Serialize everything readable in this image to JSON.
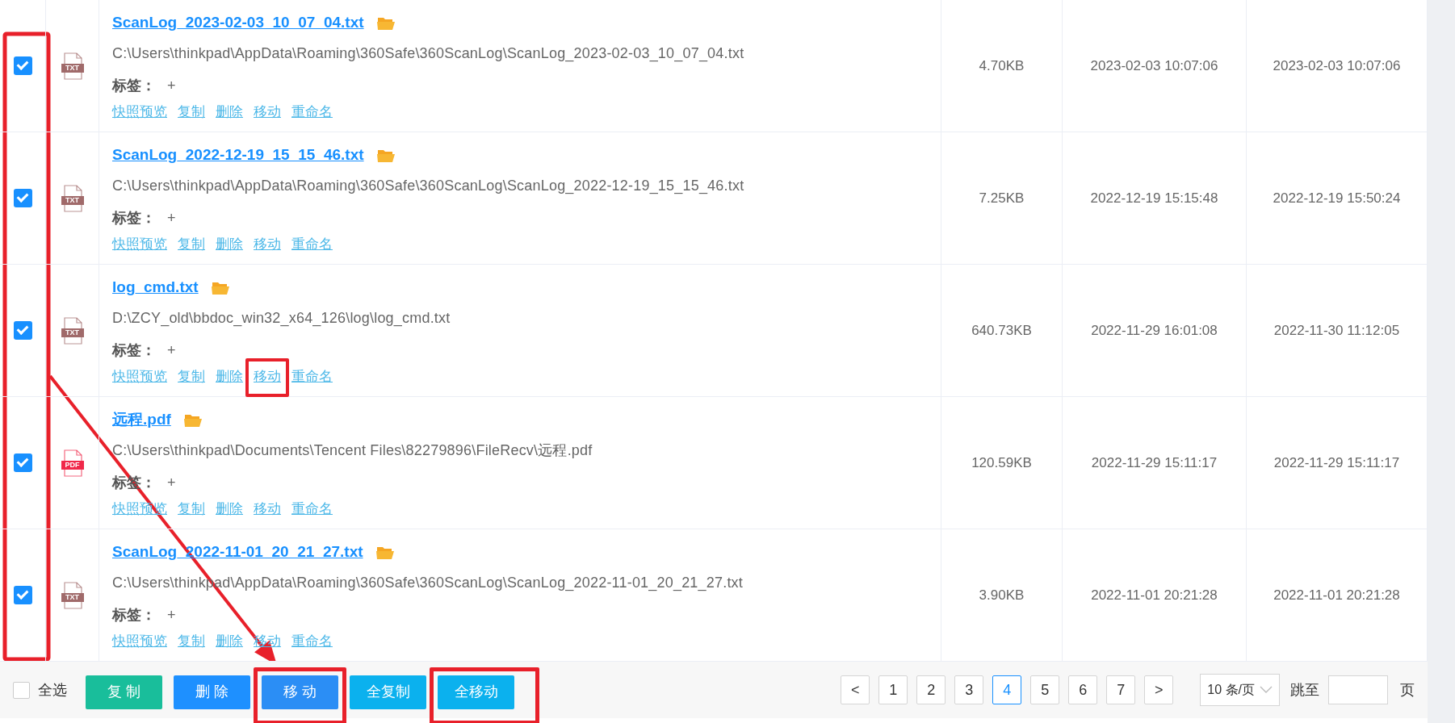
{
  "rows": [
    {
      "checked": true,
      "color": "#a06a6a",
      "type_label": "TXT",
      "name": "ScanLog_2023-02-03_10_07_04.txt",
      "path": "C:\\Users\\thinkpad\\AppData\\Roaming\\360Safe\\360ScanLog\\ScanLog_2023-02-03_10_07_04.txt",
      "tag_label": "标签：",
      "tag_add": "+",
      "actions": [
        {
          "label": "快照预览",
          "highlighted": false
        },
        {
          "label": "复制",
          "highlighted": false
        },
        {
          "label": "删除",
          "highlighted": false
        },
        {
          "label": "移动",
          "highlighted": false
        },
        {
          "label": "重命名",
          "highlighted": false
        }
      ],
      "size": "4.70KB",
      "created": "2023-02-03 10:07:06",
      "modified": "2023-02-03 10:07:06"
    },
    {
      "checked": true,
      "color": "#a06a6a",
      "type_label": "TXT",
      "name": "ScanLog_2022-12-19_15_15_46.txt",
      "path": "C:\\Users\\thinkpad\\AppData\\Roaming\\360Safe\\360ScanLog\\ScanLog_2022-12-19_15_15_46.txt",
      "tag_label": "标签：",
      "tag_add": "+",
      "actions": [
        {
          "label": "快照预览",
          "highlighted": false
        },
        {
          "label": "复制",
          "highlighted": false
        },
        {
          "label": "删除",
          "highlighted": false
        },
        {
          "label": "移动",
          "highlighted": false
        },
        {
          "label": "重命名",
          "highlighted": false
        }
      ],
      "size": "7.25KB",
      "created": "2022-12-19 15:15:48",
      "modified": "2022-12-19 15:50:24"
    },
    {
      "checked": true,
      "color": "#a06a6a",
      "type_label": "TXT",
      "name": "log_cmd.txt",
      "path": "D:\\ZCY_old\\bbdoc_win32_x64_126\\log\\log_cmd.txt",
      "tag_label": "标签：",
      "tag_add": "+",
      "actions": [
        {
          "label": "快照预览",
          "highlighted": false
        },
        {
          "label": "复制",
          "highlighted": false
        },
        {
          "label": "删除",
          "highlighted": false
        },
        {
          "label": "移动",
          "highlighted": true
        },
        {
          "label": "重命名",
          "highlighted": false
        }
      ],
      "size": "640.73KB",
      "created": "2022-11-29 16:01:08",
      "modified": "2022-11-30 11:12:05"
    },
    {
      "checked": true,
      "color": "#f0294a",
      "type_label": "PDF",
      "name": "远程.pdf",
      "path": "C:\\Users\\thinkpad\\Documents\\Tencent Files\\82279896\\FileRecv\\远程.pdf",
      "tag_label": "标签：",
      "tag_add": "+",
      "actions": [
        {
          "label": "快照预览",
          "highlighted": false
        },
        {
          "label": "复制",
          "highlighted": false
        },
        {
          "label": "删除",
          "highlighted": false
        },
        {
          "label": "移动",
          "highlighted": false
        },
        {
          "label": "重命名",
          "highlighted": false
        }
      ],
      "size": "120.59KB",
      "created": "2022-11-29 15:11:17",
      "modified": "2022-11-29 15:11:17"
    },
    {
      "checked": true,
      "color": "#a06a6a",
      "type_label": "TXT",
      "name": "ScanLog_2022-11-01_20_21_27.txt",
      "path": "C:\\Users\\thinkpad\\AppData\\Roaming\\360Safe\\360ScanLog\\ScanLog_2022-11-01_20_21_27.txt",
      "tag_label": "标签：",
      "tag_add": "+",
      "actions": [
        {
          "label": "快照预览",
          "highlighted": false
        },
        {
          "label": "复制",
          "highlighted": false
        },
        {
          "label": "删除",
          "highlighted": false
        },
        {
          "label": "移动",
          "highlighted": false
        },
        {
          "label": "重命名",
          "highlighted": false
        }
      ],
      "size": "3.90KB",
      "created": "2022-11-01 20:21:28",
      "modified": "2022-11-01 20:21:28"
    }
  ],
  "footer": {
    "select_all": {
      "label": "全选",
      "checked": false
    },
    "buttons": [
      {
        "label": "复 制",
        "kind": "copy",
        "highlighted": false
      },
      {
        "label": "删 除",
        "kind": "delete",
        "highlighted": false
      },
      {
        "label": "移 动",
        "kind": "move",
        "highlighted": true
      },
      {
        "label": "全复制",
        "kind": "copy-all",
        "highlighted": false
      },
      {
        "label": "全移动",
        "kind": "move-all",
        "highlighted": true
      }
    ],
    "pagination": {
      "prev": "<",
      "next": ">",
      "pages": [
        {
          "label": "1",
          "selected": false
        },
        {
          "label": "2",
          "selected": false
        },
        {
          "label": "3",
          "selected": false
        },
        {
          "label": "4",
          "selected": true
        },
        {
          "label": "5",
          "selected": false
        },
        {
          "label": "6",
          "selected": false
        },
        {
          "label": "7",
          "selected": false
        }
      ],
      "page_size": "10 条/页",
      "jump_label": "跳至",
      "jump_suffix": "页"
    }
  },
  "annotations": {
    "checkbox_column_outlined": true,
    "arrow_to_highlighted_button": true
  }
}
